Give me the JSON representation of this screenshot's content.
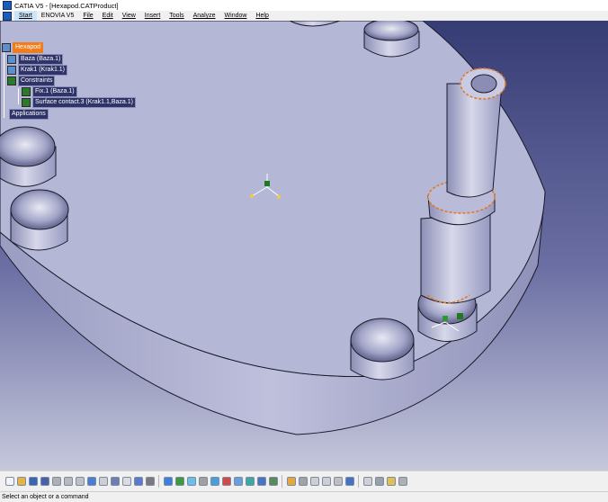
{
  "window": {
    "title": "CATIA V5 - [Hexapod.CATProduct]"
  },
  "menubar": {
    "items": [
      {
        "label": "Start"
      },
      {
        "label": "ENOVIA V5"
      },
      {
        "label": "File"
      },
      {
        "label": "Edit"
      },
      {
        "label": "View"
      },
      {
        "label": "Insert"
      },
      {
        "label": "Tools"
      },
      {
        "label": "Analyze"
      },
      {
        "label": "Window"
      },
      {
        "label": "Help"
      }
    ]
  },
  "tree": {
    "root": "Hexapod",
    "part1": "Baza (Baza.1)",
    "part2": "Krak1 (Krak1.1)",
    "constraints": "Constraints",
    "fix": "Fix.1 (Baza.1)",
    "contact": "Surface contact.3 (Krak1.1,Baza.1)",
    "applications": "Applications"
  },
  "toolbar": {
    "button_colors": [
      "#f3f3f3",
      "#e7b340",
      "#3a64b4",
      "#4a5fa8",
      "#b0b0b0",
      "#b9b9b9",
      "#c0c0c0",
      "#4a7fcf",
      "#cfcfcf",
      "#6a7fb0",
      "#dcdcdc",
      "#5b7bc8",
      "#7a7a7a",
      "#3d7fdc",
      "#3d9a3d",
      "#6ac0e8",
      "#a0a0a0",
      "#4a9fd8",
      "#d24a4a",
      "#6aa0d8",
      "#3ea8a0",
      "#4874c6",
      "#5a8a5a",
      "#e6a83c",
      "#a2a2a2",
      "#cfcfcf",
      "#cfcfcf",
      "#bfbfbf",
      "#4a6fc0",
      "#d0d0d0",
      "#9aa0a8",
      "#e0c050",
      "#b0b0b0"
    ]
  },
  "status": {
    "text": "Select an object or a command"
  }
}
